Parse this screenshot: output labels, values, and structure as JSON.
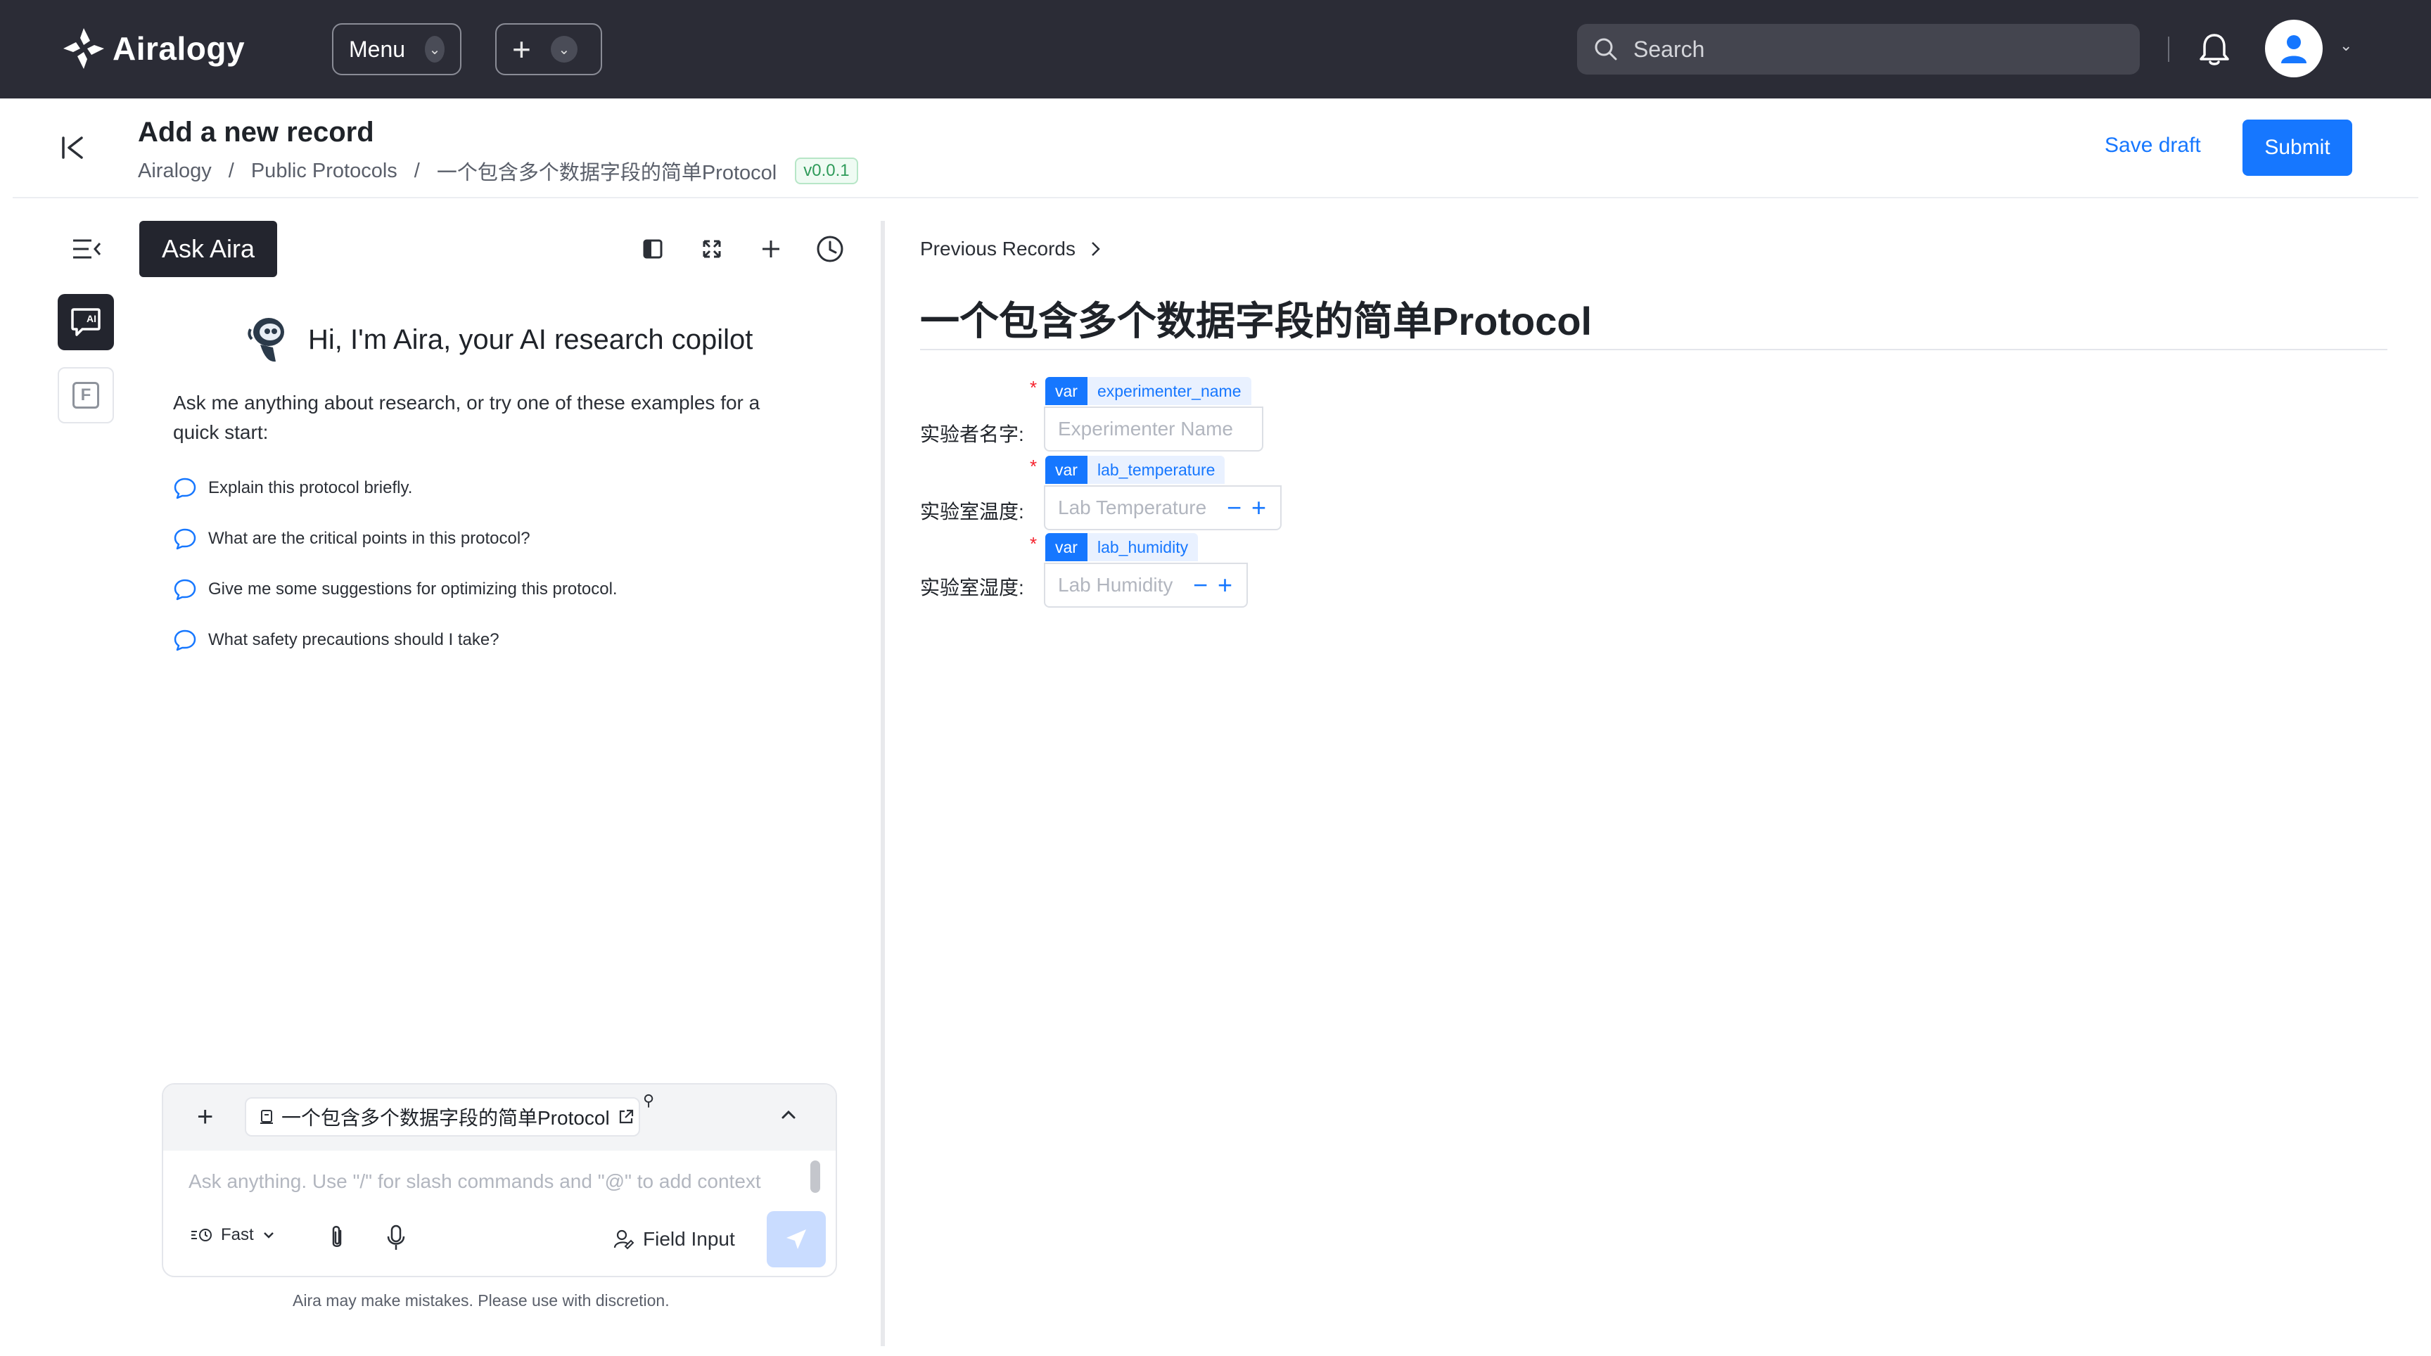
{
  "app": {
    "name": "Airalogy",
    "menu_label": "Menu",
    "search_placeholder": "Search"
  },
  "header": {
    "title": "Add a new record",
    "breadcrumb": [
      "Airalogy",
      "Public Protocols",
      "一个包含多个数据字段的简单Protocol"
    ],
    "breadcrumb_sep": "/",
    "version": "v0.0.1",
    "save_draft_label": "Save draft",
    "submit_label": "Submit"
  },
  "assistant": {
    "tab_label": "Ask Aira",
    "greeting": "Hi, I'm Aira, your AI research copilot",
    "intro": "Ask me anything about research, or try one of these examples for a quick start:",
    "suggestions": [
      "Explain this protocol briefly.",
      "What are the critical points in this protocol?",
      "Give me some suggestions for optimizing this protocol.",
      "What safety precautions should I take?"
    ],
    "context_chip": "一个包含多个数据字段的简单Protocol",
    "input_placeholder": "Ask anything. Use \"/\" for slash commands and \"@\" to add context",
    "mode_label": "Fast",
    "field_input_label": "Field Input",
    "disclaimer": "Aira may make mistakes. Please use with discretion."
  },
  "protocol": {
    "previous_records_label": "Previous Records",
    "title": "一个包含多个数据字段的简单Protocol",
    "fields": [
      {
        "label": "实验者名字:",
        "var_tag": "var",
        "var_name": "experimenter_name",
        "placeholder": "Experimenter Name",
        "required_mark": "*"
      },
      {
        "label": "实验室温度:",
        "var_tag": "var",
        "var_name": "lab_temperature",
        "placeholder": "Lab Temperature",
        "required_mark": "*"
      },
      {
        "label": "实验室湿度:",
        "var_tag": "var",
        "var_name": "lab_humidity",
        "placeholder": "Lab Humidity",
        "required_mark": "*"
      }
    ]
  },
  "colors": {
    "topbar_bg": "#2b2c36",
    "accent": "#1677ff",
    "required": "#f5222d",
    "version_green": "#2f9b5a"
  },
  "icons": [
    "airalogy-logo-icon",
    "chevron-down-icon",
    "plus-icon",
    "search-icon",
    "bell-icon",
    "user-avatar-icon",
    "collapse-left-icon",
    "sidebar-toggle-icon",
    "ai-chat-icon",
    "form-f-icon",
    "panel-layout-icon",
    "fullscreen-icon",
    "history-icon",
    "robot-icon",
    "chat-bubble-icon",
    "document-icon",
    "external-link-icon",
    "pin-icon",
    "chevron-up-icon",
    "speed-mode-icon",
    "paperclip-icon",
    "microphone-icon",
    "field-input-icon",
    "send-icon",
    "chevron-right-icon"
  ]
}
